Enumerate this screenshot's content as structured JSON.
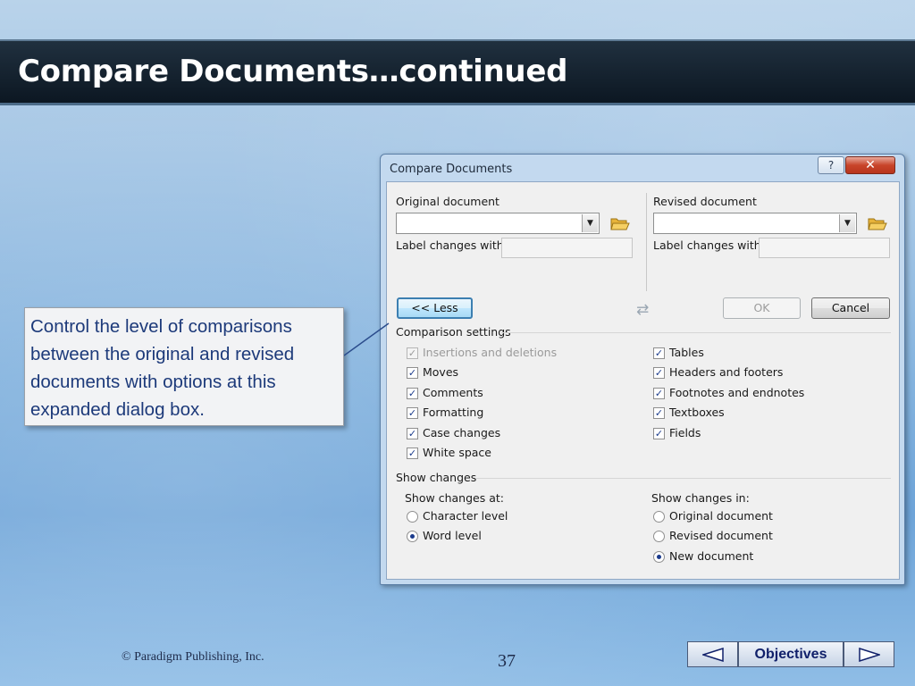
{
  "slide": {
    "title": "Compare Documents…continued",
    "callout": "Control the level of comparisons between the original and revised documents with options at this expanded dialog box.",
    "copyright": "© Paradigm Publishing, Inc.",
    "page_number": "37",
    "nav": {
      "objectives_label": "Objectives"
    }
  },
  "dialog": {
    "title": "Compare Documents",
    "help_label": "?",
    "close_label": "✕",
    "original": {
      "heading": "Original document",
      "value": "",
      "label_changes": "Label changes with",
      "label_value": ""
    },
    "revised": {
      "heading": "Revised document",
      "value": "",
      "label_changes": "Label changes with",
      "label_value": ""
    },
    "less_button": "<< Less",
    "ok_button": "OK",
    "cancel_button": "Cancel",
    "comparison_settings": {
      "heading": "Comparison settings",
      "left": [
        {
          "label": "Insertions and deletions",
          "checked": true,
          "disabled": true
        },
        {
          "label": "Moves",
          "checked": true,
          "disabled": false
        },
        {
          "label": "Comments",
          "checked": true,
          "disabled": false
        },
        {
          "label": "Formatting",
          "checked": true,
          "disabled": false
        },
        {
          "label": "Case changes",
          "checked": true,
          "disabled": false
        },
        {
          "label": "White space",
          "checked": true,
          "disabled": false
        }
      ],
      "right": [
        {
          "label": "Tables",
          "checked": true
        },
        {
          "label": "Headers and footers",
          "checked": true
        },
        {
          "label": "Footnotes and endnotes",
          "checked": true
        },
        {
          "label": "Textboxes",
          "checked": true
        },
        {
          "label": "Fields",
          "checked": true
        }
      ]
    },
    "show_changes": {
      "heading": "Show changes",
      "at_heading": "Show changes at:",
      "at_options": [
        {
          "label": "Character level",
          "selected": false
        },
        {
          "label": "Word level",
          "selected": true
        }
      ],
      "in_heading": "Show changes in:",
      "in_options": [
        {
          "label": "Original document",
          "selected": false
        },
        {
          "label": "Revised document",
          "selected": false
        },
        {
          "label": "New document",
          "selected": true
        }
      ]
    }
  }
}
